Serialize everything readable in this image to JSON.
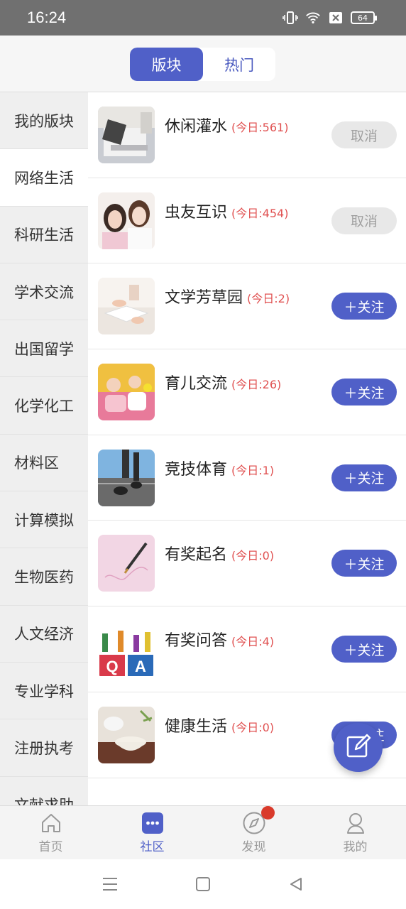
{
  "status_bar": {
    "time": "16:24",
    "battery": "64"
  },
  "segment": {
    "tabs": [
      {
        "label": "版块"
      },
      {
        "label": "热门"
      }
    ],
    "active_index": 0
  },
  "sidebar": {
    "active_index": 1,
    "items": [
      {
        "label": "我的版块"
      },
      {
        "label": "网络生活"
      },
      {
        "label": "科研生活"
      },
      {
        "label": "学术交流"
      },
      {
        "label": "出国留学"
      },
      {
        "label": "化学化工"
      },
      {
        "label": "材料区"
      },
      {
        "label": "计算模拟"
      },
      {
        "label": "生物医药"
      },
      {
        "label": "人文经济"
      },
      {
        "label": "专业学科"
      },
      {
        "label": "注册执考"
      },
      {
        "label": "文献求助"
      }
    ]
  },
  "boards": [
    {
      "name": "休闲灌水",
      "count": "(今日:561)",
      "button": "取消",
      "followed": true
    },
    {
      "name": "虫友互识",
      "count": "(今日:454)",
      "button": "取消",
      "followed": true
    },
    {
      "name": "文学芳草园",
      "count": "(今日:2)",
      "button": "＋关注",
      "followed": false
    },
    {
      "name": "育儿交流",
      "count": "(今日:26)",
      "button": "＋关注",
      "followed": false
    },
    {
      "name": "竞技体育",
      "count": "(今日:1)",
      "button": "＋关注",
      "followed": false
    },
    {
      "name": "有奖起名",
      "count": "(今日:0)",
      "button": "＋关注",
      "followed": false
    },
    {
      "name": "有奖问答",
      "count": "(今日:4)",
      "button": "＋关注",
      "followed": false
    },
    {
      "name": "健康生活",
      "count": "(今日:0)",
      "button": "＋关注",
      "followed": false
    }
  ],
  "bottom_nav": [
    {
      "label": "首页",
      "icon": "home-icon"
    },
    {
      "label": "社区",
      "icon": "community-icon"
    },
    {
      "label": "发现",
      "icon": "compass-icon"
    },
    {
      "label": "我的",
      "icon": "user-icon"
    }
  ],
  "bottom_nav_active": 1,
  "colors": {
    "accent": "#5060c8",
    "count": "#e05050",
    "badge": "#d93a2b"
  }
}
